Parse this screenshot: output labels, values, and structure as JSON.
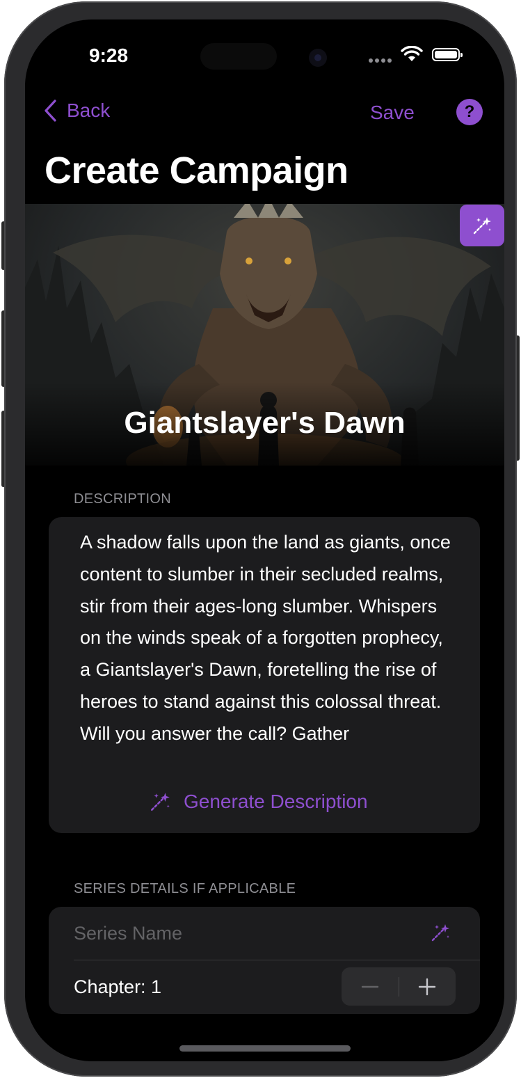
{
  "status_bar": {
    "time": "9:28"
  },
  "nav": {
    "back_label": "Back",
    "save_label": "Save",
    "help_label": "?"
  },
  "page": {
    "title": "Create Campaign"
  },
  "hero": {
    "campaign_title": "Giantslayer's Dawn",
    "image_icon": "magic-wand-icon"
  },
  "description_section": {
    "header": "DESCRIPTION",
    "text": "A shadow falls upon the land as giants, once content to slumber in their secluded realms, stir from their ages-long slumber. Whispers on the winds speak of a forgotten prophecy, a Giantslayer's Dawn, foretelling the rise of heroes to stand against this colossal threat. Will you answer the call? Gather",
    "generate_label": "Generate Description"
  },
  "series_section": {
    "header": "SERIES DETAILS IF APPLICABLE",
    "series_name_placeholder": "Series Name",
    "series_name_value": "",
    "chapter_label": "Chapter: 1",
    "chapter_value": 1
  },
  "colors": {
    "accent": "#8e4fcf",
    "background": "#000000",
    "card": "#1c1c1e",
    "secondary_text": "#8e8e93"
  }
}
